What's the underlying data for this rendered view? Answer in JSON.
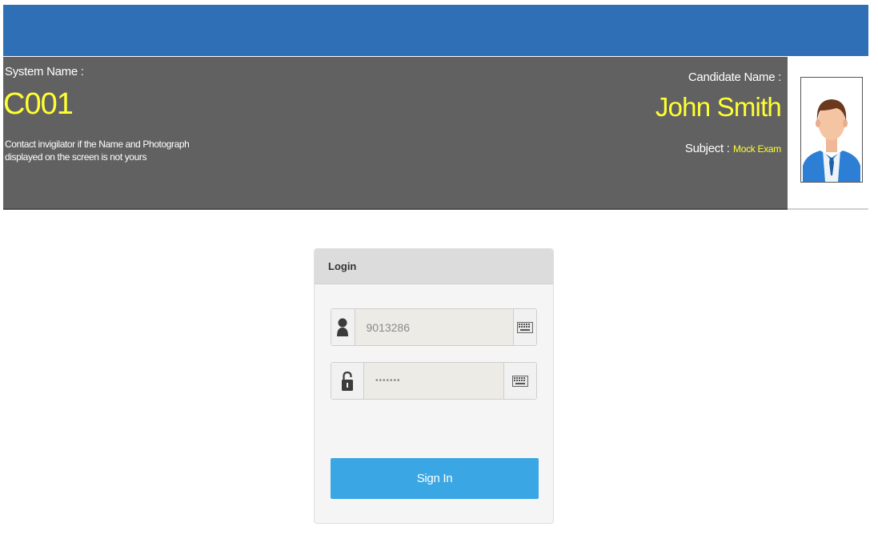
{
  "header": {
    "system_label": "System Name :",
    "system_value": "C001",
    "contact_note": "Contact invigilator if the Name and Photograph displayed on the screen is not yours",
    "candidate_label": "Candidate Name :",
    "candidate_value": "John Smith",
    "subject_label": "Subject :",
    "subject_value": "Mock Exam",
    "colors": {
      "top_bar": "#2e6fb5",
      "info_bar": "#616161",
      "highlight": "#ffff33"
    }
  },
  "login": {
    "title": "Login",
    "username": {
      "value": "9013286",
      "icon": "user-icon",
      "keyboard_icon": "keyboard-icon"
    },
    "password": {
      "value": "•••••••",
      "icon": "lock-icon",
      "keyboard_icon": "keyboard-icon"
    },
    "signin_label": "Sign In",
    "colors": {
      "signin_button": "#3aa6e3"
    }
  },
  "photo": {
    "icon": "candidate-photo"
  }
}
